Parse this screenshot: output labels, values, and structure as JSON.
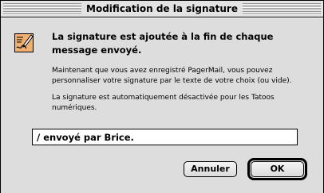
{
  "window": {
    "title": "Modification de la signature"
  },
  "dialog": {
    "icon": "signature-pen-icon",
    "headline": "La signature est ajoutée à la fin de chaque message envoyé.",
    "paragraph1": "Maintenant que vous avez enregistré PagerMail, vous pouvez personnaliser votre signature par le texte de votre choix (ou vide).",
    "paragraph2": "La signature est automatiquement désactivée pour les Tatoos numériques.",
    "signature_field": {
      "value": "/ envoyé par Brice."
    },
    "buttons": {
      "cancel_label": "Annuler",
      "ok_label": "OK"
    }
  },
  "colors": {
    "window_background": "#dddddd",
    "icon_accent": "#f0b070"
  }
}
